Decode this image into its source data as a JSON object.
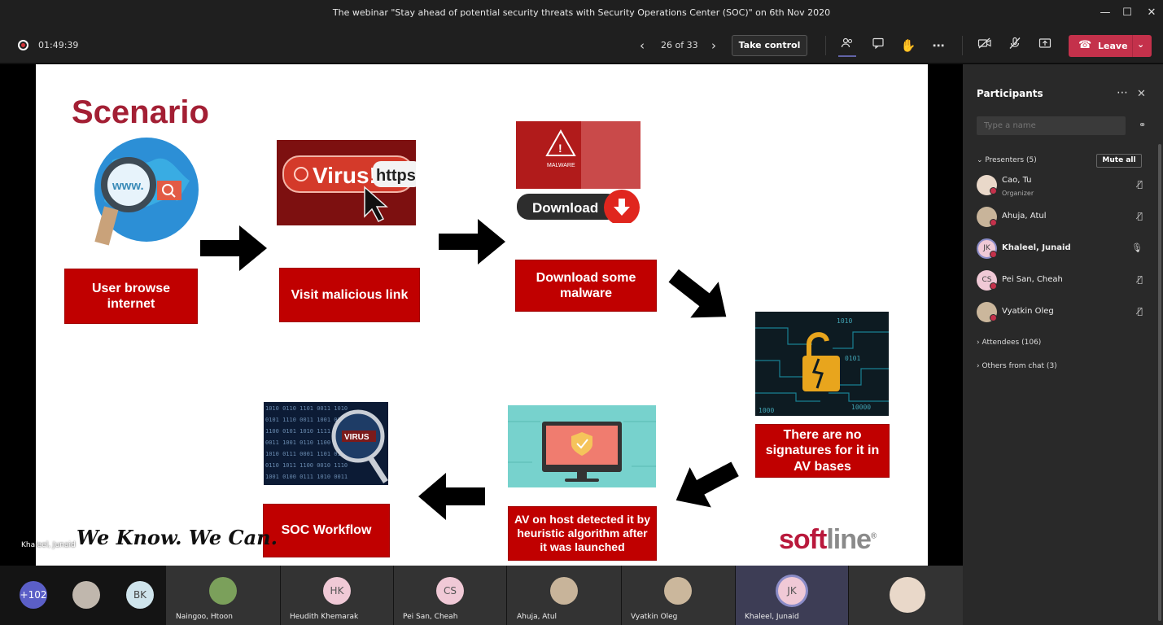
{
  "window": {
    "title": "The webinar \"Stay ahead of potential security threats with Security Operations Center (SOC)\" on 6th Nov 2020",
    "minimize_icon": "minimize-icon",
    "maximize_icon": "maximize-icon",
    "close_icon": "close-icon"
  },
  "toolbar": {
    "recording_time": "01:49:39",
    "slide_counter": "26 of 33",
    "take_control_label": "Take control",
    "leave_label": "Leave",
    "icons": [
      "participants-icon",
      "chat-icon",
      "raise-hand-icon",
      "more-actions-icon",
      "camera-off-icon",
      "mic-off-icon",
      "share-screen-icon"
    ]
  },
  "slide": {
    "title": "Scenario",
    "steps": [
      "User browse internet",
      "Visit malicious link",
      "Download some malware",
      "There are no signatures for it in AV bases",
      "AV on host detected it by heuristic algorithm after it was launched",
      "SOC Workflow"
    ],
    "image_text": {
      "virus_banner": "Virus!",
      "https_text": "https:/",
      "download_label": "Download",
      "www_text": "www.",
      "virus_lens": "VIRUS",
      "malware_text": "MALWARE"
    },
    "motto": "We Know. We Can.",
    "logo_soft": "soft",
    "logo_line": "line",
    "logo_mark": "®",
    "speaker_label": "Khaleel, Junaid"
  },
  "participants": {
    "title": "Participants",
    "search_placeholder": "Type a name",
    "presenters_label": "Presenters (5)",
    "mute_all_label": "Mute all",
    "presenters": [
      {
        "name": "Cao, Tu",
        "role": "Organizer",
        "initials": "",
        "bg": "#e9d8c9"
      },
      {
        "name": "Ahuja, Atul",
        "role": "",
        "initials": "",
        "bg": "#c8b49a"
      },
      {
        "name": "Khaleel, Junaid",
        "role": "",
        "initials": "JK",
        "bg": "#f0c9d6"
      },
      {
        "name": "Pei San, Cheah",
        "role": "",
        "initials": "CS",
        "bg": "#f0c9d6"
      },
      {
        "name": "Vyatkin Oleg",
        "role": "",
        "initials": "",
        "bg": "#cbb79c"
      }
    ],
    "attendees_label": "Attendees (106)",
    "others_label": "Others from chat (3)"
  },
  "strip": {
    "overflow_count": "+102",
    "bk_initials": "BK",
    "tiles": [
      {
        "name": "Naingoo, Htoon",
        "initials": "",
        "bg": "#7ba05b"
      },
      {
        "name": "Heudith Khemarak",
        "initials": "HK",
        "bg": "#f0c9d6"
      },
      {
        "name": "Pei San, Cheah",
        "initials": "CS",
        "bg": "#f0c9d6"
      },
      {
        "name": "Ahuja, Atul",
        "initials": "",
        "bg": "#c8b49a"
      },
      {
        "name": "Vyatkin Oleg",
        "initials": "",
        "bg": "#cbb79c"
      },
      {
        "name": "Khaleel, Junaid",
        "initials": "JK",
        "bg": "#f0c9d6"
      },
      {
        "name": "",
        "initials": "",
        "bg": "#e9d8c9"
      }
    ]
  },
  "colors": {
    "accent": "#6264a7",
    "leave": "#c4314b",
    "slide_red": "#c00000",
    "title_red": "#a31f34"
  }
}
